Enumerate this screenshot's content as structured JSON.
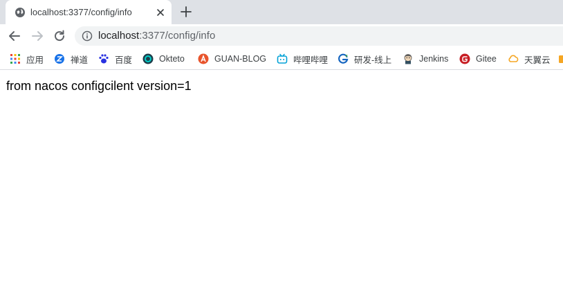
{
  "tab": {
    "title": "localhost:3377/config/info",
    "favicon": "globe-icon"
  },
  "address_bar": {
    "host": "localhost",
    "path": ":3377/config/info",
    "icon": "info-icon"
  },
  "bookmarks": [
    {
      "label": "应用",
      "icon": "apps-grid-icon"
    },
    {
      "label": "禅道",
      "icon": "zentao-icon"
    },
    {
      "label": "百度",
      "icon": "baidu-paw-icon"
    },
    {
      "label": "Okteto",
      "icon": "okteto-icon"
    },
    {
      "label": "GUAN-BLOG",
      "icon": "guan-blog-icon"
    },
    {
      "label": "哔哩哔哩",
      "icon": "bilibili-icon"
    },
    {
      "label": "研发-线上",
      "icon": "dev-online-icon"
    },
    {
      "label": "Jenkins",
      "icon": "jenkins-icon"
    },
    {
      "label": "Gitee",
      "icon": "gitee-icon"
    },
    {
      "label": "天翼云",
      "icon": "tianyi-cloud-icon"
    }
  ],
  "page": {
    "text": "from nacos configcilent version=1"
  },
  "colors": {
    "tabstrip": "#dee1e6",
    "omnibox": "#f1f3f4",
    "text": "#000000"
  }
}
